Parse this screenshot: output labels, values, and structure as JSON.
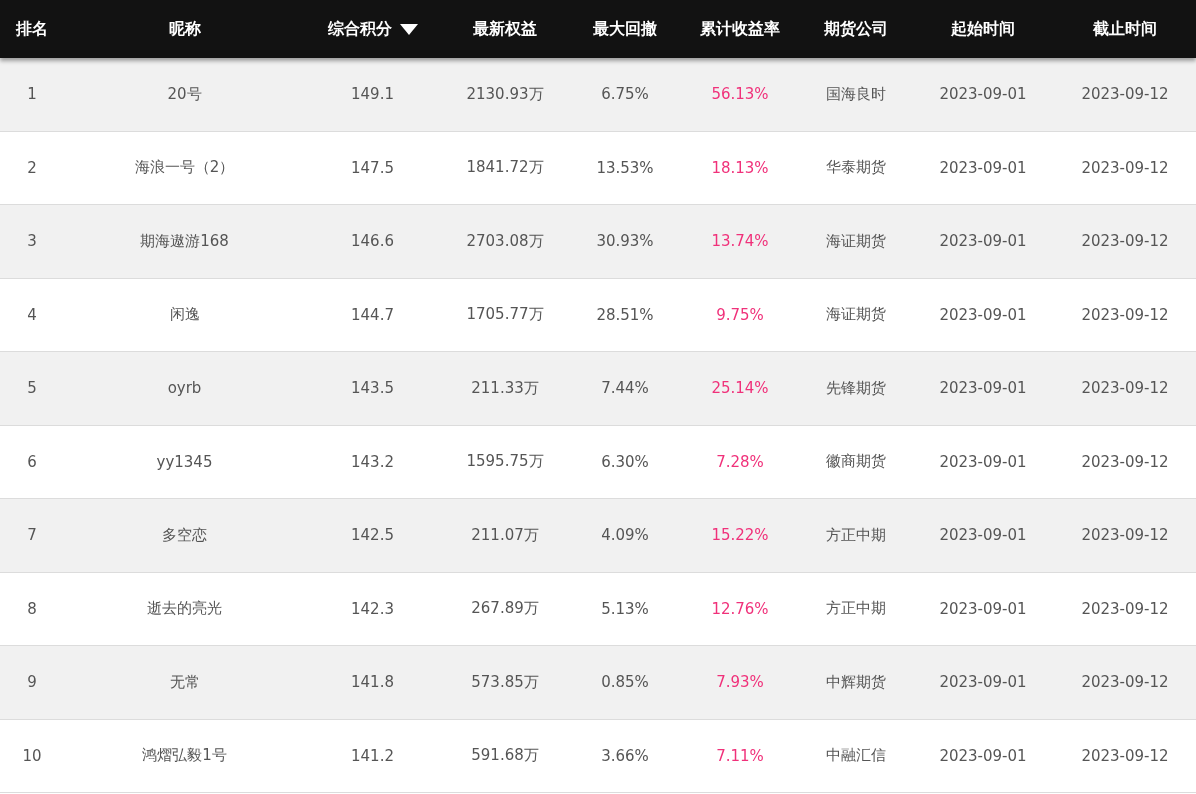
{
  "table": {
    "columns": [
      {
        "label": "排名",
        "kind": "plain",
        "sorted": false
      },
      {
        "label": "昵称",
        "kind": "plain",
        "sorted": false
      },
      {
        "label": "综合积分",
        "kind": "plain",
        "sorted": true
      },
      {
        "label": "最新权益",
        "kind": "plain",
        "sorted": false
      },
      {
        "label": "最大回撤",
        "kind": "plain",
        "sorted": false
      },
      {
        "label": "累计收益率",
        "kind": "gain",
        "sorted": false
      },
      {
        "label": "期货公司",
        "kind": "plain",
        "sorted": false
      },
      {
        "label": "起始时间",
        "kind": "plain",
        "sorted": false
      },
      {
        "label": "截止时间",
        "kind": "plain",
        "sorted": false
      }
    ],
    "rows": [
      [
        "1",
        "20号",
        "149.1",
        "2130.93万",
        "6.75%",
        "56.13%",
        "国海良时",
        "2023-09-01",
        "2023-09-12"
      ],
      [
        "2",
        "海浪一号（2）",
        "147.5",
        "1841.72万",
        "13.53%",
        "18.13%",
        "华泰期货",
        "2023-09-01",
        "2023-09-12"
      ],
      [
        "3",
        "期海遨游168",
        "146.6",
        "2703.08万",
        "30.93%",
        "13.74%",
        "海证期货",
        "2023-09-01",
        "2023-09-12"
      ],
      [
        "4",
        "闲逸",
        "144.7",
        "1705.77万",
        "28.51%",
        "9.75%",
        "海证期货",
        "2023-09-01",
        "2023-09-12"
      ],
      [
        "5",
        "oyrb",
        "143.5",
        "211.33万",
        "7.44%",
        "25.14%",
        "先锋期货",
        "2023-09-01",
        "2023-09-12"
      ],
      [
        "6",
        "yy1345",
        "143.2",
        "1595.75万",
        "6.30%",
        "7.28%",
        "徽商期货",
        "2023-09-01",
        "2023-09-12"
      ],
      [
        "7",
        "多空恋",
        "142.5",
        "211.07万",
        "4.09%",
        "15.22%",
        "方正中期",
        "2023-09-01",
        "2023-09-12"
      ],
      [
        "8",
        "逝去的亮光",
        "142.3",
        "267.89万",
        "5.13%",
        "12.76%",
        "方正中期",
        "2023-09-01",
        "2023-09-12"
      ],
      [
        "9",
        "无常",
        "141.8",
        "573.85万",
        "0.85%",
        "7.93%",
        "中辉期货",
        "2023-09-01",
        "2023-09-12"
      ],
      [
        "10",
        "鸿熠弘毅1号",
        "141.2",
        "591.68万",
        "3.66%",
        "7.11%",
        "中融汇信",
        "2023-09-01",
        "2023-09-12"
      ]
    ]
  }
}
